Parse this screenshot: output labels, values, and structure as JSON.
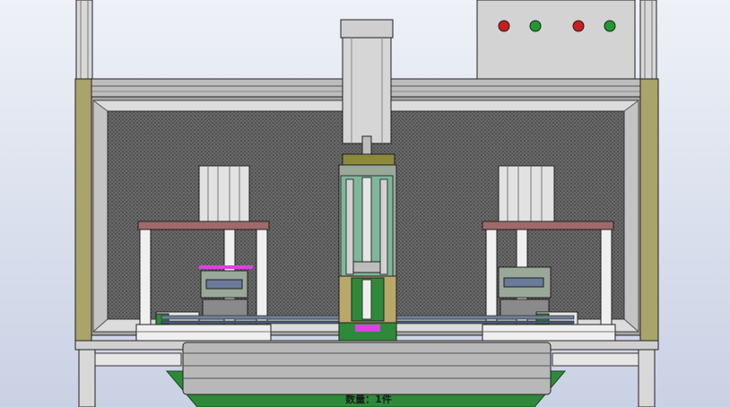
{
  "drawing": {
    "quantity_label": "数量：1件"
  },
  "control_panel": {
    "indicators": [
      {
        "name": "red-indicator-light",
        "color": "#c81e1e"
      },
      {
        "name": "green-indicator-light",
        "color": "#1e9a2e"
      },
      {
        "name": "red-indicator-light",
        "color": "#c81e1e"
      },
      {
        "name": "green-indicator-light",
        "color": "#1e9a2e"
      }
    ]
  },
  "colors": {
    "frame": "#d6d6d6",
    "enclosure_olive": "#a8a46a",
    "mesh": "#5a5a5a",
    "clamp_bar": "#a06a6a",
    "base_green": "#2e8a3a",
    "cylinder": "#d2d2d2"
  }
}
